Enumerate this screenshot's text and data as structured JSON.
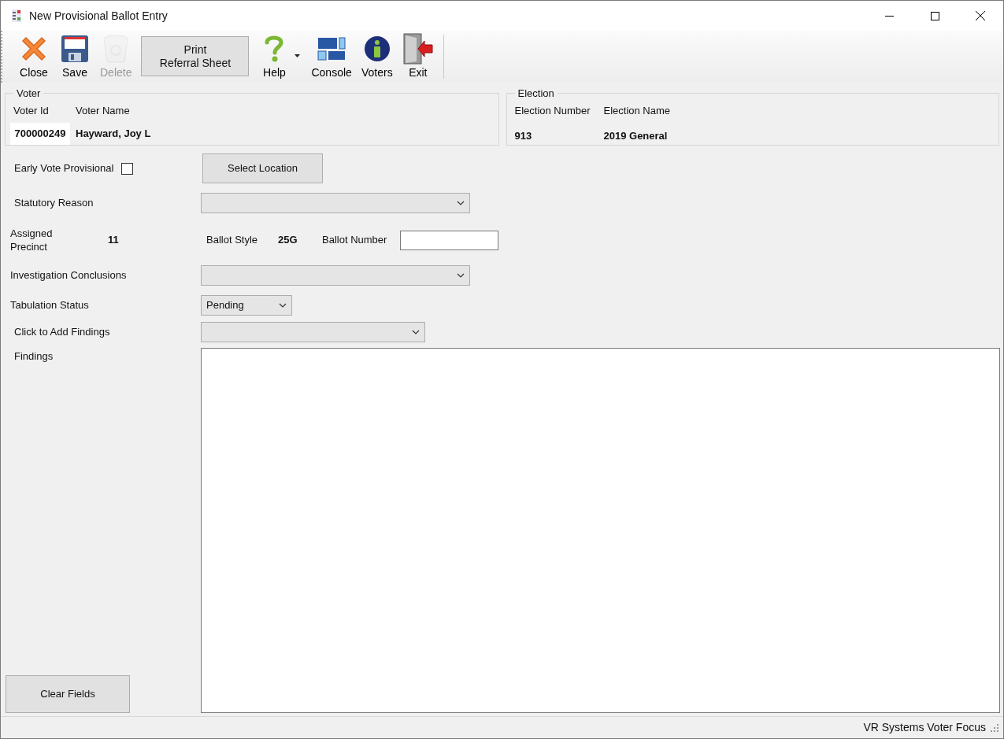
{
  "window": {
    "title": "New Provisional Ballot Entry"
  },
  "toolbar": [
    {
      "kind": "icon",
      "label": "Close",
      "disabled": false
    },
    {
      "kind": "icon",
      "label": "Save",
      "disabled": false
    },
    {
      "kind": "icon",
      "label": "Delete",
      "disabled": true
    },
    {
      "kind": "button",
      "label": "Print\nReferral Sheet"
    },
    {
      "kind": "icon",
      "label": "Help",
      "disabled": false,
      "dropdown": true
    },
    {
      "kind": "icon",
      "label": "Console",
      "disabled": false
    },
    {
      "kind": "icon",
      "label": "Voters",
      "disabled": false
    },
    {
      "kind": "icon",
      "label": "Exit",
      "disabled": false
    }
  ],
  "voter": {
    "title": "Voter",
    "id_label": "Voter Id",
    "name_label": "Voter Name",
    "id": "700000249",
    "name": "Hayward, Joy L"
  },
  "election": {
    "title": "Election",
    "number_label": "Election Number",
    "name_label": "Election Name",
    "number": "913",
    "name": "2019 General"
  },
  "early_vote": {
    "label": "Early Vote Provisional",
    "checked": false
  },
  "select_location": "Select Location",
  "statutory_reason": {
    "label": "Statutory Reason"
  },
  "assigned_precinct": {
    "label": "Assigned\nPrecinct",
    "value": "11"
  },
  "ballot_style": {
    "label": "Ballot Style",
    "value": "25G"
  },
  "ballot_number": {
    "label": "Ballot Number"
  },
  "investigation_conclusions": {
    "label": "Investigation Conclusions"
  },
  "tabulation_status": {
    "label": "Tabulation Status",
    "value": "Pending"
  },
  "add_findings": {
    "label": "Click to Add Findings"
  },
  "findings": {
    "label": "Findings"
  },
  "clear_fields": "Clear Fields",
  "status_bar": "VR Systems Voter Focus"
}
